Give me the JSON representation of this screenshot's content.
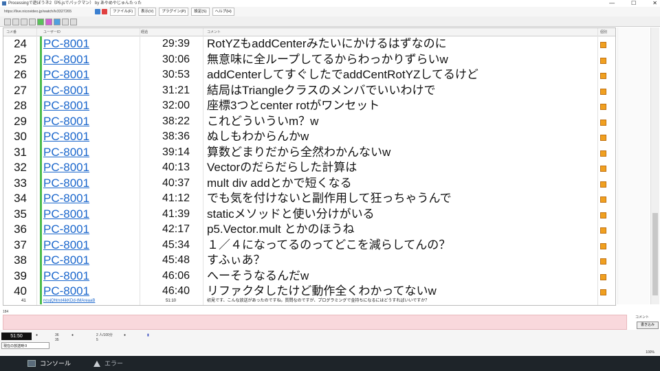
{
  "window": {
    "title": "Processingで遊ぼうネ2（P5.jsでパックマン） by あやめやじゅんたった",
    "controls": [
      "—",
      "☐",
      "✕"
    ]
  },
  "urlbar": {
    "url": "https://live.nicovideo.jp/watch/lv3327265"
  },
  "menu": [
    "ファイル(F)",
    "表示(V)",
    "プラグイン(P)",
    "設定(S)",
    "ヘルプ(H)"
  ],
  "grid": {
    "headers": [
      "コメ番",
      "ユーザーID",
      "経過",
      "コメント",
      "個別"
    ],
    "rows": [
      {
        "no": "24",
        "user": "PC-8001",
        "time": "29:39",
        "comment": "RotYZもaddCenterみたいにかけるはずなのに"
      },
      {
        "no": "25",
        "user": "PC-8001",
        "time": "30:06",
        "comment": "無意味に全ループしてるからわっかりずらいw"
      },
      {
        "no": "26",
        "user": "PC-8001",
        "time": "30:53",
        "comment": "addCenterしてすぐしたでaddCentRotYZしてるけど"
      },
      {
        "no": "27",
        "user": "PC-8001",
        "time": "31:21",
        "comment": "結局はTriangleクラスのメンバでいいわけで"
      },
      {
        "no": "28",
        "user": "PC-8001",
        "time": "32:00",
        "comment": "座標3つとcenter rotがワンセット"
      },
      {
        "no": "29",
        "user": "PC-8001",
        "time": "38:22",
        "comment": "これどういういm？w"
      },
      {
        "no": "30",
        "user": "PC-8001",
        "time": "38:36",
        "comment": "ぬしもわからんかw"
      },
      {
        "no": "31",
        "user": "PC-8001",
        "time": "39:14",
        "comment": "算数どまりだから全然わかんないw"
      },
      {
        "no": "32",
        "user": "PC-8001",
        "time": "40:13",
        "comment": "Vectorのだらだらした計算は"
      },
      {
        "no": "33",
        "user": "PC-8001",
        "time": "40:37",
        "comment": "mult div addとかで短くなる"
      },
      {
        "no": "34",
        "user": "PC-8001",
        "time": "41:12",
        "comment": "でも気を付けないと副作用して狂っちゃうんで"
      },
      {
        "no": "35",
        "user": "PC-8001",
        "time": "41:39",
        "comment": "staticメソッドと使い分けがいる"
      },
      {
        "no": "36",
        "user": "PC-8001",
        "time": "42:17",
        "comment": "p5.Vector.mult とかのほうね"
      },
      {
        "no": "37",
        "user": "PC-8001",
        "time": "45:34",
        "comment": "１／４になってるのってどこを減らしてんの？"
      },
      {
        "no": "38",
        "user": "PC-8001",
        "time": "45:48",
        "comment": "すふぃあ？"
      },
      {
        "no": "39",
        "user": "PC-8001",
        "time": "46:06",
        "comment": "へーそうなるんだw"
      },
      {
        "no": "40",
        "user": "PC-8001",
        "time": "46:40",
        "comment": "リファクタしたけど動作全くわかってないw"
      }
    ],
    "last_row": {
      "no": "41",
      "user": "ncujQhtrxt4ikKDd-tMAreaaB",
      "time": "51:10",
      "comment": "初見です、こんな放送があったのですね。質問なのですが、プログラミングで金持ちになるにはどうすればいいですか？"
    }
  },
  "comment_bar": {
    "anon_label": "184",
    "checkbox_label": "コメント",
    "send_label": "書き込み"
  },
  "status": {
    "elapsed": "51:50",
    "visitors": "36",
    "comments": "35",
    "viewers": "2 人/100分",
    "viewers_sub": "5",
    "select_value": "現在の放送時:9",
    "zoom": "100%"
  },
  "bottom_tabs": {
    "console": "コンソール",
    "error": "エラー"
  },
  "colors": {
    "link": "#1a66cc",
    "accent_green": "#4cbb4c",
    "pink_input": "#f9d8dc",
    "bottom_bar": "#1e2429"
  }
}
